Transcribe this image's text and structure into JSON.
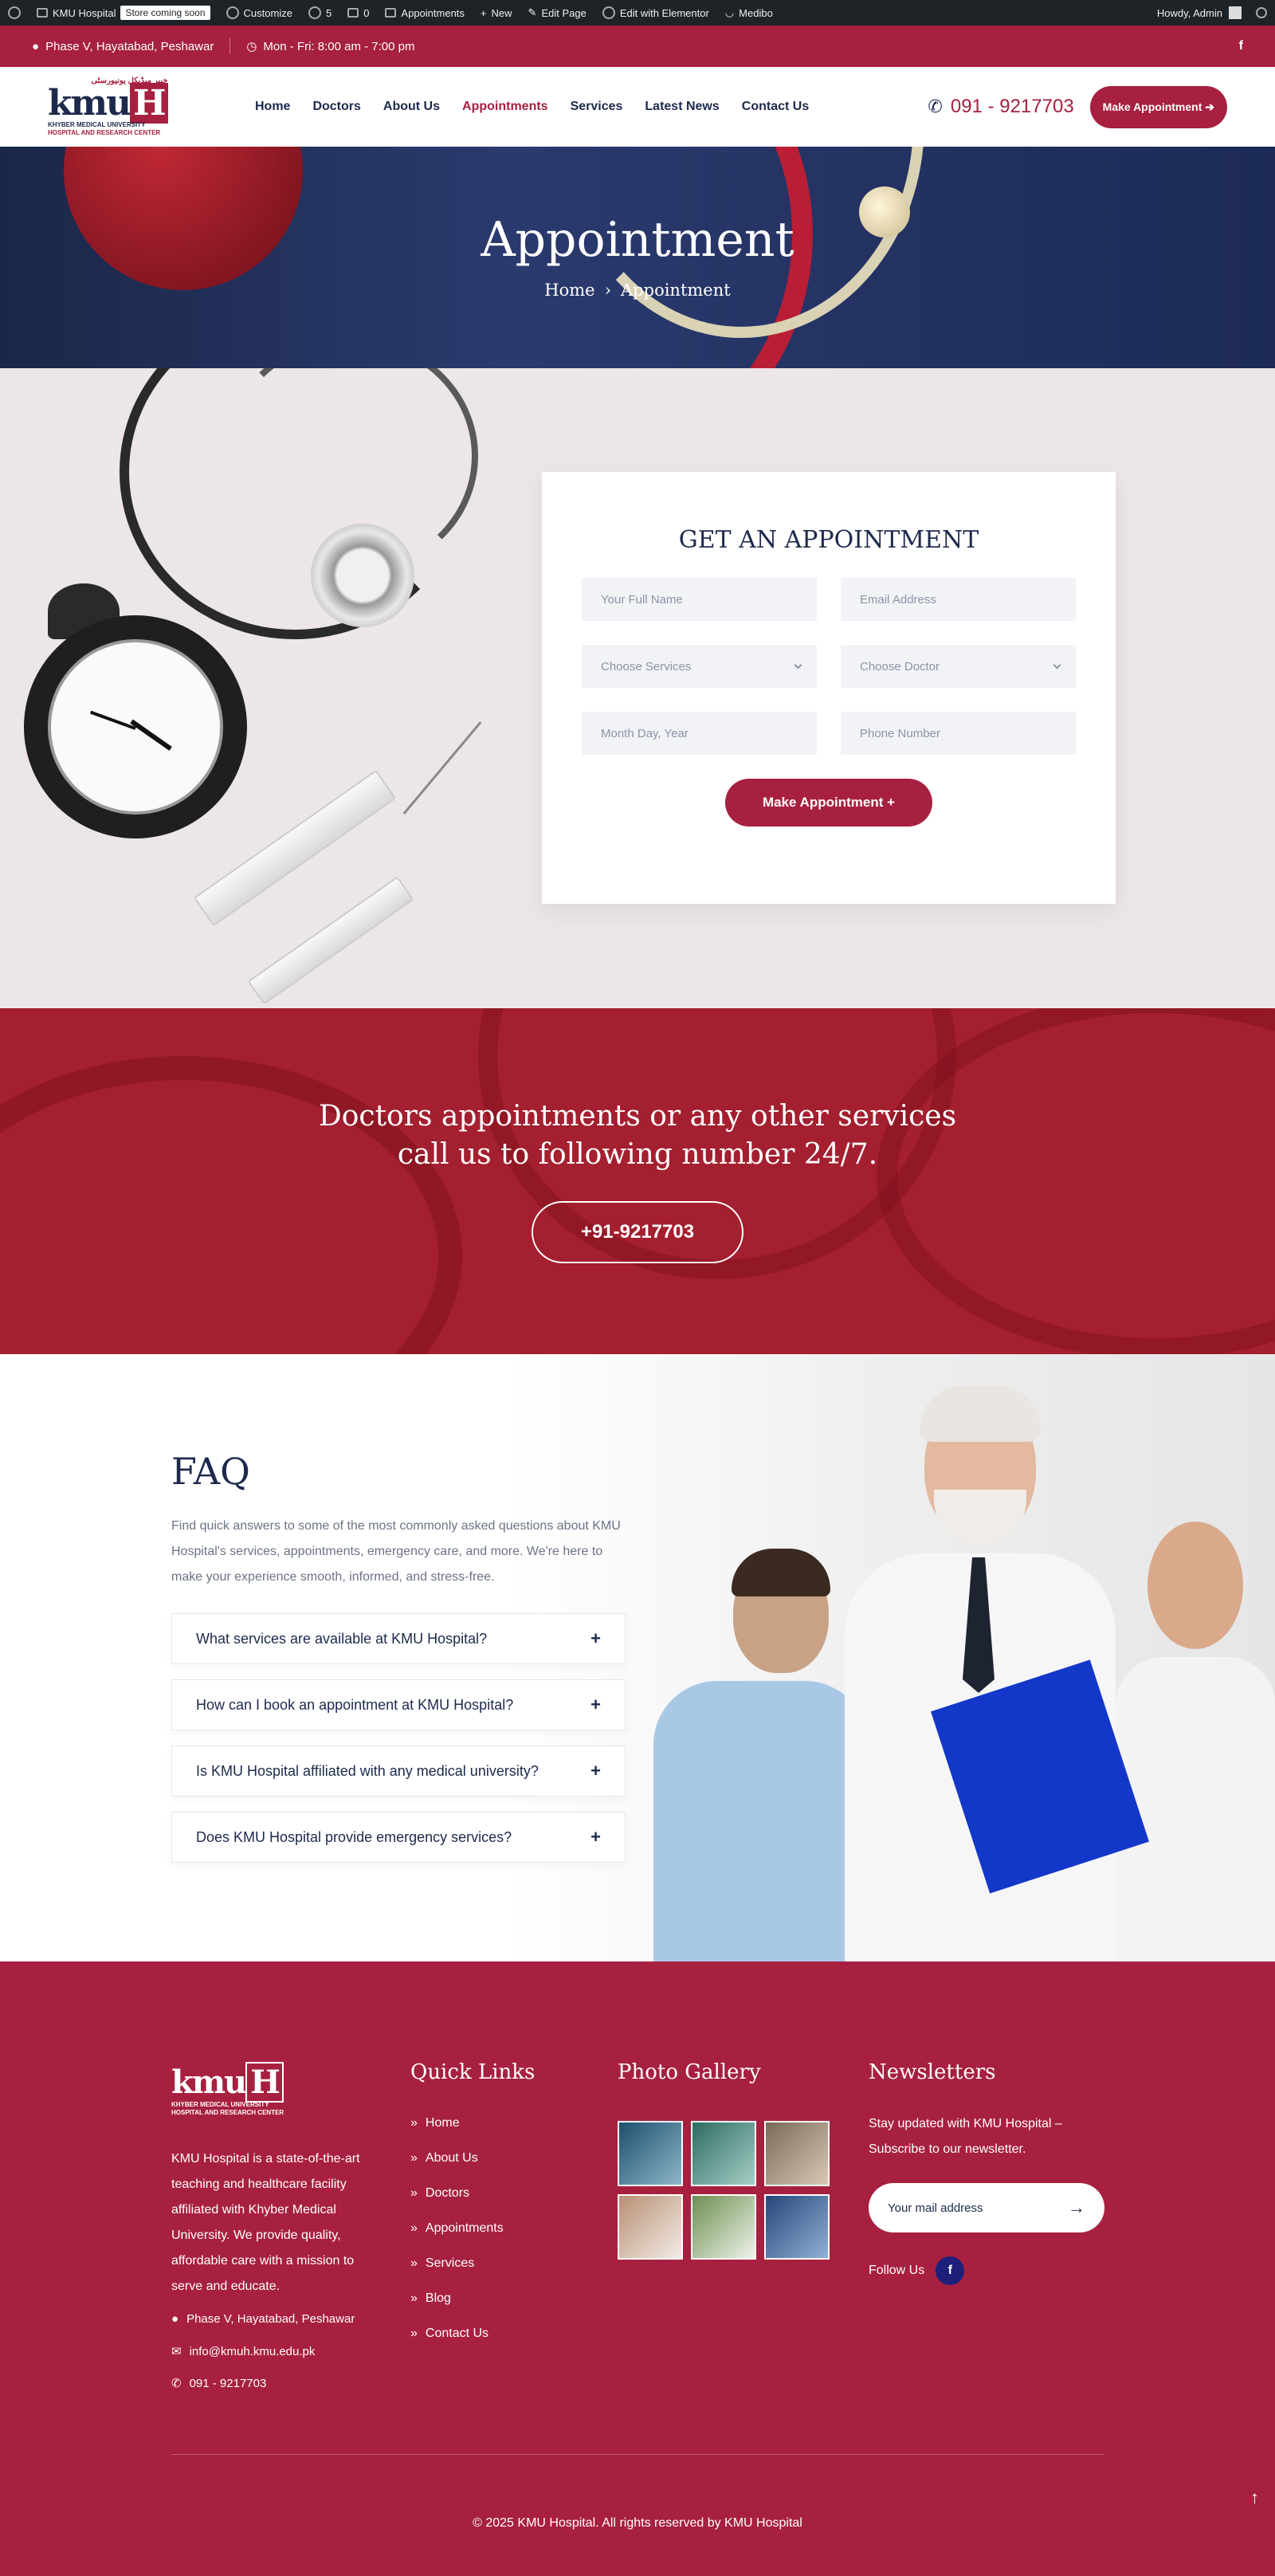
{
  "adminbar": {
    "site_name": "KMU Hospital",
    "store_badge": "Store coming soon",
    "customize": "Customize",
    "updates_count": "5",
    "comments_count": "0",
    "appointments": "Appointments",
    "new": "New",
    "edit_page": "Edit Page",
    "elementor": "Edit with Elementor",
    "theme": "Medibo",
    "howdy": "Howdy, Admin"
  },
  "topbar": {
    "address": "Phase V, Hayatabad, Peshawar",
    "hours": "Mon - Fri: 8:00 am - 7:00 pm",
    "social": "f"
  },
  "header": {
    "logo_mark": "kmu",
    "logo_h": "H",
    "logo_urdu": "خیبر میڈیکل یونیورسٹی",
    "logo_sub1": "KHYBER MEDICAL UNIVERSITY",
    "logo_sub2": "HOSPITAL AND RESEARCH CENTER",
    "nav": [
      "Home",
      "Doctors",
      "About Us",
      "Appointments",
      "Services",
      "Latest News",
      "Contact Us"
    ],
    "phone": "091 - 9217703",
    "cta": "Make Appointment ➔"
  },
  "hero": {
    "title": "Appointment",
    "crumb_home": "Home",
    "crumb_sep": "›",
    "crumb_current": "Appointment"
  },
  "form": {
    "title": "GET AN APPOINTMENT",
    "name_placeholder": "Your Full Name",
    "email_placeholder": "Email Address",
    "services_placeholder": "Choose Services",
    "doctor_placeholder": "Choose Doctor",
    "date_placeholder": "Month Day, Year",
    "phone_placeholder": "Phone Number",
    "submit": "Make Appointment +"
  },
  "cta": {
    "line1": "Doctors appointments or any other services",
    "line2": "call us to following number 24/7.",
    "phone": "+91-9217703"
  },
  "faq": {
    "title": "FAQ",
    "description": "Find quick answers to some of the most commonly asked questions about KMU Hospital's services, appointments, emergency care, and more. We're here to make your experience smooth, informed, and stress-free.",
    "items": [
      "What services are available at KMU Hospital?",
      "How can I book an appointment at KMU Hospital?",
      "Is KMU Hospital affiliated with any medical university?",
      "Does KMU Hospital provide emergency services?"
    ]
  },
  "footer": {
    "logo_mark": "kmu",
    "logo_h": "H",
    "logo_sub1": "KHYBER MEDICAL UNIVERSITY",
    "logo_sub2": "HOSPITAL AND RESEARCH CENTER",
    "about": "KMU Hospital is a state-of-the-art teaching and healthcare facility affiliated with Khyber Medical University. We provide quality, affordable care with a mission to serve and educate.",
    "address": "Phase V, Hayatabad, Peshawar",
    "email": "info@kmuh.kmu.edu.pk",
    "phone": "091 - 9217703",
    "quick_links_title": "Quick Links",
    "quick_links": [
      "Home",
      "About Us",
      "Doctors",
      "Appointments",
      "Services",
      "Blog",
      "Contact Us"
    ],
    "gallery_title": "Photo Gallery",
    "newsletter_title": "Newsletters",
    "newsletter_text": "Stay updated with KMU Hospital – Subscribe to our newsletter.",
    "newsletter_placeholder": "Your mail address",
    "follow_us": "Follow Us",
    "copyright": "© 2025 KMU Hospital. All rights reserved by KMU Hospital"
  }
}
